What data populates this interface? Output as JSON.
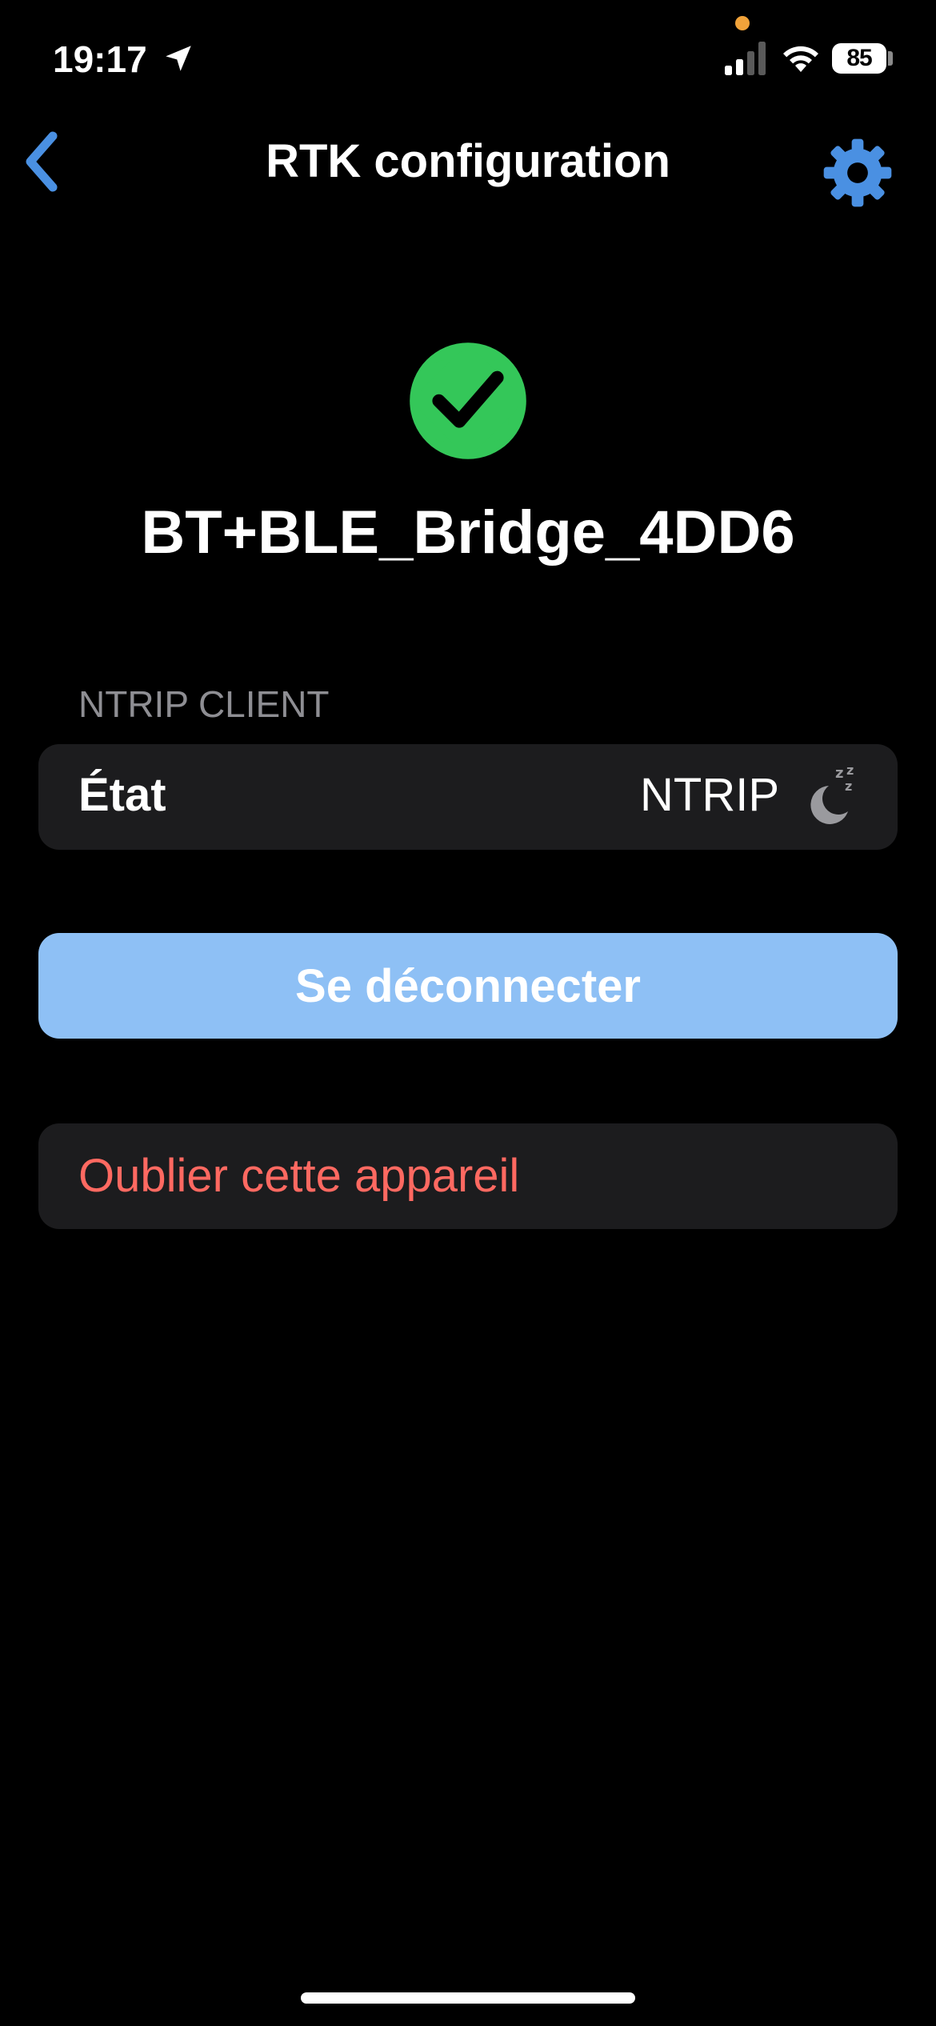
{
  "status_bar": {
    "time": "19:17",
    "battery": "85",
    "icons": [
      "location-arrow-icon",
      "cellular-signal-icon",
      "wifi-icon",
      "battery-icon"
    ]
  },
  "nav": {
    "title": "RTK configuration",
    "back_icon": "chevron-left-icon",
    "settings_icon": "gear-icon"
  },
  "device": {
    "name": "BT+BLE_Bridge_4DD6",
    "status_icon": "verified-check-badge-icon"
  },
  "ntrip_section": {
    "header": "NTRIP CLIENT",
    "row_label": "État",
    "row_value": "NTRIP",
    "row_icon": "moon-zzz-sleep-icon"
  },
  "actions": {
    "disconnect": "Se déconnecter",
    "forget": "Oublier cette appareil"
  },
  "colors": {
    "accent": "#4a90e2",
    "success": "#34c759",
    "destructive": "#ff6961",
    "card": "#1c1c1e",
    "button_disabled": "#8ec0f5"
  }
}
